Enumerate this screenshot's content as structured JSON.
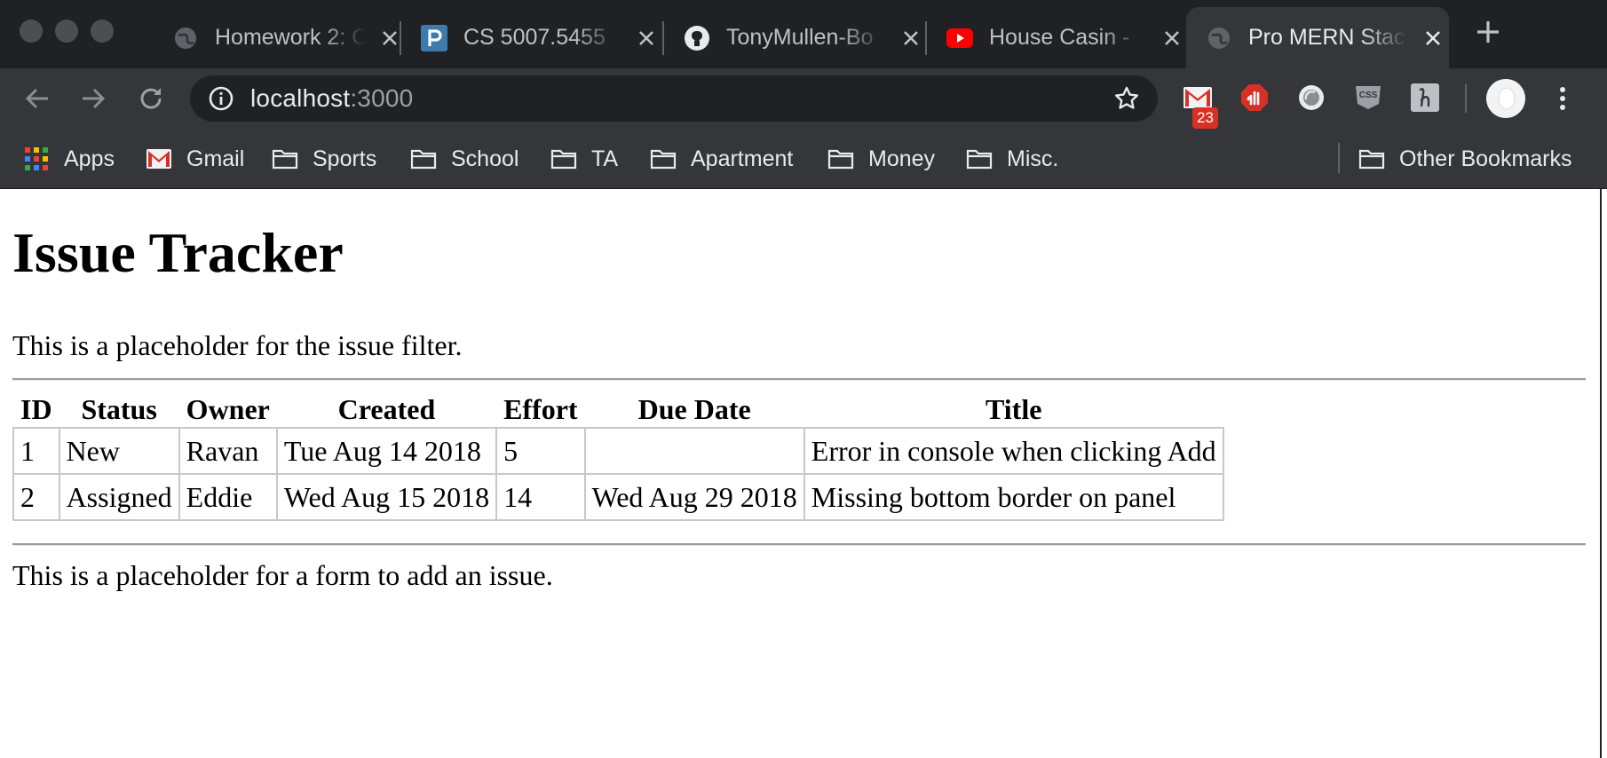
{
  "browser": {
    "tabs": [
      {
        "title": "Homework 2: C",
        "favicon": "globe-icon"
      },
      {
        "title": "CS 5007.5455",
        "favicon": "piazza-icon"
      },
      {
        "title": "TonyMullen-Bo",
        "favicon": "github-icon"
      },
      {
        "title": "House Casin -",
        "favicon": "youtube-icon"
      },
      {
        "title": "Pro MERN Stac",
        "favicon": "globe-icon",
        "active": true
      }
    ],
    "url": {
      "host": "localhost",
      "port": ":3000"
    },
    "extension_badge": "23",
    "bookmarks": [
      {
        "label": "Apps",
        "icon": "apps-grid-icon"
      },
      {
        "label": "Gmail",
        "icon": "gmail-icon"
      },
      {
        "label": "Sports",
        "icon": "folder-icon"
      },
      {
        "label": "School",
        "icon": "folder-icon"
      },
      {
        "label": "TA",
        "icon": "folder-icon"
      },
      {
        "label": "Apartment",
        "icon": "folder-icon"
      },
      {
        "label": "Money",
        "icon": "folder-icon"
      },
      {
        "label": "Misc.",
        "icon": "folder-icon"
      }
    ],
    "other_bookmarks": "Other Bookmarks",
    "colors": {
      "tabstrip": "#202124",
      "toolbar": "#35363a",
      "text": "#e8eaed"
    }
  },
  "page": {
    "heading": "Issue Tracker",
    "filter_placeholder": "This is a placeholder for the issue filter.",
    "add_placeholder": "This is a placeholder for a form to add an issue.",
    "table": {
      "headers": [
        "ID",
        "Status",
        "Owner",
        "Created",
        "Effort",
        "Due Date",
        "Title"
      ],
      "rows": [
        [
          "1",
          "New",
          "Ravan",
          "Tue Aug 14 2018",
          "5",
          "",
          "Error in console when clicking Add"
        ],
        [
          "2",
          "Assigned",
          "Eddie",
          "Wed Aug 15 2018",
          "14",
          "Wed Aug 29 2018",
          "Missing bottom border on panel"
        ]
      ]
    }
  }
}
